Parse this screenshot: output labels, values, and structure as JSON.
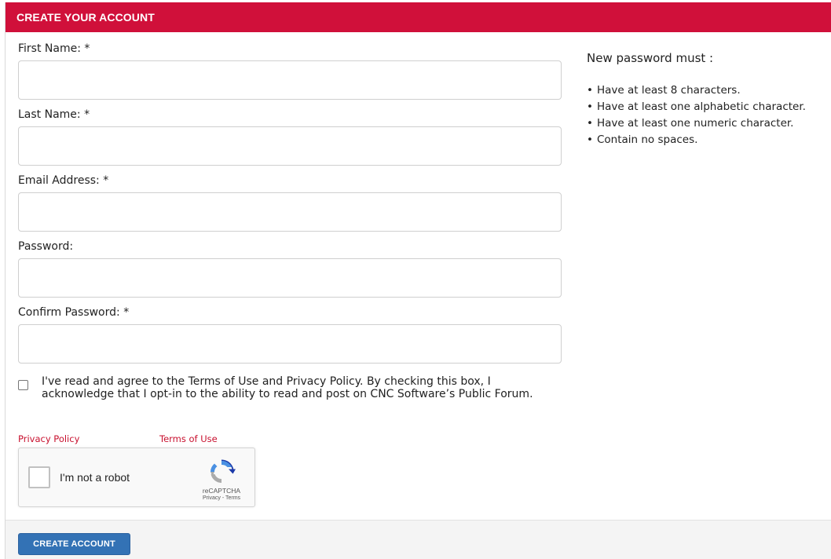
{
  "header": {
    "title": "CREATE YOUR ACCOUNT"
  },
  "form": {
    "first_name_label": "First Name: *",
    "first_name_value": "",
    "last_name_label": "Last Name: *",
    "last_name_value": "",
    "email_label": "Email Address: *",
    "email_value": "",
    "password_label": "Password:",
    "password_value": "",
    "confirm_password_label": "Confirm Password: *",
    "confirm_password_value": ""
  },
  "password_rules": {
    "title": "New password must :",
    "items": [
      "Have at least 8 characters.",
      "Have at least one alphabetic character.",
      "Have at least one numeric character.",
      "Contain no spaces."
    ]
  },
  "agreement": {
    "checked": false,
    "text": "I've read and agree to the Terms of Use and Privacy Policy. By checking this box, I acknowledge that I opt-in to the ability to read and post on CNC Software’s Public Forum."
  },
  "links": {
    "privacy_policy": "Privacy Policy",
    "terms_of_use": "Terms of Use"
  },
  "recaptcha": {
    "label": "I'm not a robot",
    "brand": "reCAPTCHA",
    "sub": "Privacy - Terms",
    "logo_icon": "recaptcha-logo-icon"
  },
  "footer": {
    "create_button": "CREATE ACCOUNT"
  },
  "colors": {
    "header_red": "#d0103a",
    "link_red": "#c8102e",
    "button_blue": "#3372b5"
  }
}
